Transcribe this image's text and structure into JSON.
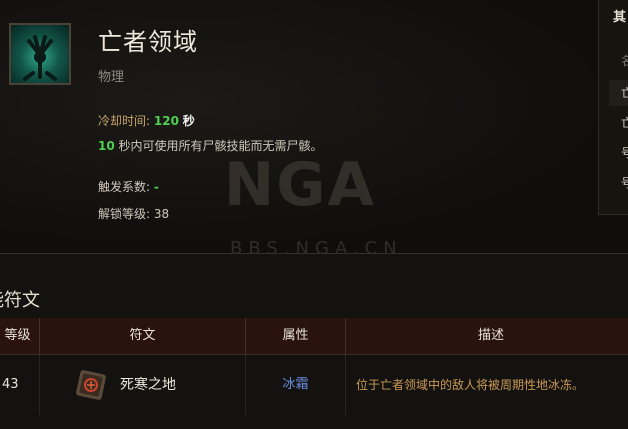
{
  "skill": {
    "title": "亡者领域",
    "type": "物理",
    "cooldown_label": "冷却时间:",
    "cooldown_value": "120",
    "cooldown_unit": "秒",
    "desc_value": "10",
    "desc_text": "秒内可使用所有尸骸技能而无需尸骸。",
    "trigger_label": "触发系数:",
    "trigger_value": "-",
    "unlock_label": "解锁等级:",
    "unlock_value": "38",
    "icon": "bone-hand-skill-icon"
  },
  "side_panel": {
    "title": "其",
    "head": "名",
    "rows": [
      "亡",
      "亡",
      "号",
      "号"
    ]
  },
  "watermark": {
    "logo": "NGA",
    "url": "BBS.NGA.CN"
  },
  "runes_section": {
    "title": "能符文",
    "headers": {
      "level": "等级",
      "rune": "符文",
      "attribute": "属性",
      "description": "描述"
    },
    "rows": [
      {
        "level": "43",
        "rune": "死寒之地",
        "attribute": "冰霜",
        "description": "位于亡者领域中的敌人将被周期性地冰冻。",
        "icon": "rune-icon"
      }
    ]
  },
  "colors": {
    "accent_green": "#4fd14f",
    "label_orange": "#c8a46a",
    "frost_blue": "#6b8fe0",
    "desc_gold": "#c89a55",
    "header_red": "#2a120e"
  }
}
